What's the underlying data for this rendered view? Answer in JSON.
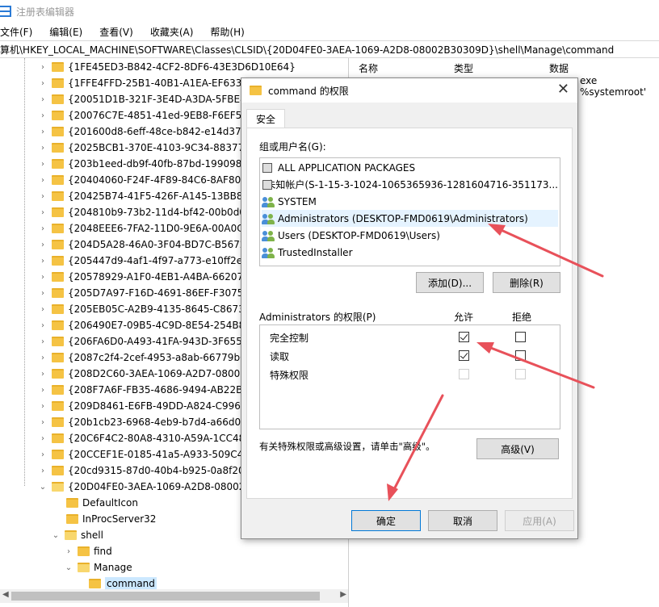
{
  "window": {
    "title": "注册表编辑器"
  },
  "menu": [
    "文件(F)",
    "编辑(E)",
    "查看(V)",
    "收藏夹(A)",
    "帮助(H)"
  ],
  "address": "计算机\\HKEY_LOCAL_MACHINE\\SOFTWARE\\Classes\\CLSID\\{20D04FE0-3AEA-1069-A2D8-08002B30309D}\\shell\\Manage\\command",
  "tree": {
    "items": [
      "{1FE45ED3-B842-4CF2-8DF6-43E3D6D10E64}",
      "{1FFE4FFD-25B1-40B1-A1EA-EF633358",
      "{20051D1B-321F-3E4D-A3DA-5FBE89",
      "{20076C7E-4851-41ed-9EB8-F6EF5F2B",
      "{201600d8-6eff-48ce-b842-e14d37a0",
      "{2025BCB1-370E-4103-9C34-883770F",
      "{203b1eed-db9f-40fb-87bd-1990982",
      "{20404060-F24F-4F89-84C6-8AF80B0A",
      "{20425B74-41F5-426F-A145-13BB845",
      "{204810b9-73b2-11d4-bf42-00b0d01",
      "{2048EEE6-7FA2-11D0-9E6A-00A0C91",
      "{204D5A28-46A0-3F04-BD7C-B56726",
      "{205447d9-4af1-4f97-a773-e10ff2e44",
      "{20578929-A1F0-4EB1-A4BA-662072",
      "{205D7A97-F16D-4691-86EF-F3075DC",
      "{205EB05C-A2B9-4135-8645-C8673A",
      "{206490E7-09B5-4C9D-8E54-254B87A",
      "{206FA6D0-A493-41FA-943D-3F65508",
      "{2087c2f4-2cef-4953-a8ab-66779b67",
      "{208D2C60-3AEA-1069-A2D7-08002B",
      "{208F7A6F-FB35-4686-9494-AB22B7B",
      "{209D8461-E6FB-49DD-A824-C9962A",
      "{20b1cb23-6968-4eb9-b7d4-a66d00c",
      "{20C6F4C2-80A8-4310-A59A-1CC487",
      "{20CCEF1E-0185-41a5-A933-509C43B",
      "{20cd9315-87d0-40b4-b925-0a8f208",
      "{20D04FE0-3AEA-1069-A2D8-08002B3"
    ],
    "children": [
      "DefaultIcon",
      "InProcServer32",
      "shell"
    ],
    "shell_children": [
      "find",
      "Manage"
    ],
    "selected": "command"
  },
  "columns": {
    "name": "名称",
    "type": "类型",
    "data": "数据"
  },
  "value_preview": "exe %systemroot'",
  "dialog": {
    "title": "command 的权限",
    "tab": "安全",
    "groups_label": "组或用户名(G):",
    "users": [
      "ALL APPLICATION PACKAGES",
      "未知帐户(S-1-15-3-1024-1065365936-1281604716-351173...",
      "SYSTEM",
      "Administrators (DESKTOP-FMD0619\\Administrators)",
      "Users (DESKTOP-FMD0619\\Users)",
      "TrustedInstaller"
    ],
    "add_button": "添加(D)...",
    "remove_button": "删除(R)",
    "perm_label": "Administrators 的权限(P)",
    "allow_label": "允许",
    "deny_label": "拒绝",
    "permissions": [
      {
        "name": "完全控制",
        "allow": true,
        "deny": false
      },
      {
        "name": "读取",
        "allow": true,
        "deny": false
      },
      {
        "name": "特殊权限",
        "allow": false,
        "deny": false
      }
    ],
    "advanced_hint": "有关特殊权限或高级设置，请单击\"高级\"。",
    "advanced_button": "高级(V)",
    "ok_button": "确定",
    "cancel_button": "取消",
    "apply_button": "应用(A)"
  },
  "colors": {
    "arrow": "#e8515a",
    "selection": "#cce8ff",
    "highlight": "#e5f3ff",
    "folder": "#f5c344"
  }
}
